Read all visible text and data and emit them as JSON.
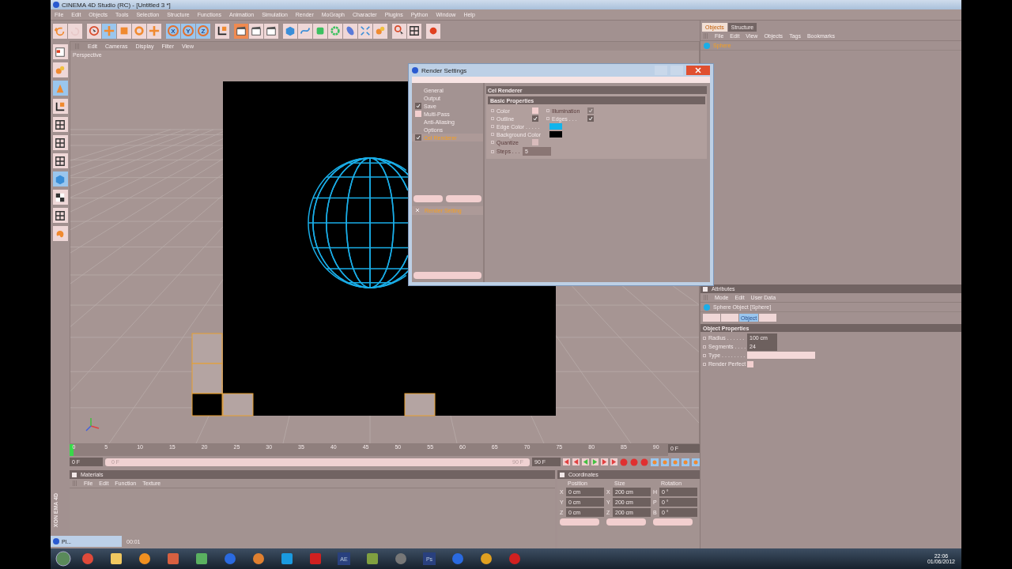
{
  "window": {
    "title": "CINEMA 4D Studio (RC) - [Untitled 3 *]"
  },
  "menu": [
    "File",
    "Edit",
    "Objects",
    "Tools",
    "Selection",
    "Structure",
    "Functions",
    "Animation",
    "Simulation",
    "Render",
    "MoGraph",
    "Character",
    "Plugins",
    "Python",
    "Window",
    "Help"
  ],
  "toolbar": [
    {
      "kind": "curved-arrow",
      "selected": false
    },
    {
      "kind": "faded-arrow",
      "selected": false
    },
    {
      "kind": "cursor",
      "selected": false
    },
    {
      "kind": "cross-arrows",
      "selected": true
    },
    {
      "kind": "square",
      "selected": false
    },
    {
      "kind": "ring",
      "selected": false
    },
    {
      "kind": "axis-arrows",
      "selected": false
    },
    {
      "kind": "axis",
      "label": "X",
      "selected": true
    },
    {
      "kind": "axis",
      "label": "Y",
      "selected": true
    },
    {
      "kind": "axis",
      "label": "Z",
      "selected": true
    },
    {
      "kind": "corner-axes",
      "selected": false
    },
    {
      "kind": "clapperboard",
      "selected": true
    },
    {
      "kind": "clapperboard",
      "selected": false
    },
    {
      "kind": "clapperboard",
      "selected": false
    },
    {
      "kind": "cube",
      "selected": false
    },
    {
      "kind": "curve",
      "selected": false
    },
    {
      "kind": "beveled-cube",
      "selected": false
    },
    {
      "kind": "gear",
      "selected": false
    },
    {
      "kind": "capsule",
      "selected": false
    },
    {
      "kind": "scatter-arrows",
      "selected": false
    },
    {
      "kind": "blobs",
      "selected": false
    },
    {
      "kind": "cursor-dot",
      "selected": false
    },
    {
      "kind": "grid",
      "selected": false
    },
    {
      "kind": "record",
      "selected": false
    }
  ],
  "left_tools": [
    {
      "kind": "window-layout",
      "selected": false
    },
    {
      "kind": "blobs",
      "selected": false
    },
    {
      "kind": "cone",
      "selected": true
    },
    {
      "kind": "corner-axes",
      "selected": false
    },
    {
      "kind": "grid",
      "selected": false
    },
    {
      "kind": "grid",
      "selected": false
    },
    {
      "kind": "grid",
      "selected": false
    },
    {
      "kind": "cube",
      "selected": true
    },
    {
      "kind": "checkerboard",
      "selected": false
    },
    {
      "kind": "grid",
      "selected": false
    },
    {
      "kind": "blob",
      "selected": false
    }
  ],
  "viewport": {
    "menu": [
      "Edit",
      "Cameras",
      "Display",
      "Filter",
      "View"
    ],
    "camera": "Perspective"
  },
  "render_settings": {
    "title": "Render Settings",
    "tree": [
      {
        "label": "General",
        "kind": "plain",
        "selected": false
      },
      {
        "label": "Output",
        "kind": "plain",
        "selected": false
      },
      {
        "label": "Save",
        "kind": "check",
        "checked": true,
        "selected": false
      },
      {
        "label": "Multi-Pass",
        "kind": "check",
        "checked": false,
        "selected": false
      },
      {
        "label": "Anti-Aliasing",
        "kind": "plain",
        "selected": false
      },
      {
        "label": "Options",
        "kind": "plain",
        "selected": false
      },
      {
        "label": "Cel Renderer",
        "kind": "check",
        "checked": true,
        "selected": true
      }
    ],
    "setting": "Render Setting",
    "panel_title": "Cel Renderer",
    "section": "Basic Properties",
    "params": [
      [
        {
          "label": "Color",
          "kind": "checkbox",
          "checked": false,
          "disabled": false
        },
        {
          "label": "Illumination",
          "kind": "checkbox",
          "checked": true,
          "disabled": true
        }
      ],
      [
        {
          "label": "Outline",
          "kind": "checkbox",
          "checked": true,
          "disabled": false
        },
        {
          "label": "Edges . . .",
          "kind": "checkbox",
          "checked": true,
          "disabled": false
        }
      ],
      [
        {
          "label": "Edge Color . . . . .",
          "kind": "color",
          "color": "#12b4ec",
          "disabled": false
        }
      ],
      [
        {
          "label": "Background Color",
          "kind": "color",
          "color": "#000000",
          "disabled": false
        }
      ],
      [
        {
          "label": "Quantize",
          "kind": "checkbox",
          "checked": false,
          "disabled": true
        }
      ],
      [
        {
          "label": "Steps . . .",
          "kind": "number",
          "value": "5",
          "disabled": true
        }
      ]
    ]
  },
  "objects_panel": {
    "tabs": [
      {
        "label": "Objects",
        "selected": true
      },
      {
        "label": "Structure",
        "selected": false
      }
    ],
    "menu": [
      "File",
      "Edit",
      "View",
      "Objects",
      "Tags",
      "Bookmarks"
    ],
    "objects": [
      {
        "name": "Sphere",
        "selected": true
      }
    ]
  },
  "attributes": {
    "title": "Attributes",
    "menu": [
      "Mode",
      "Edit",
      "User Data"
    ],
    "object": "Sphere Object [Sphere]",
    "tabs": [
      {
        "selected": false
      },
      {
        "selected": false
      },
      {
        "label": "Object",
        "selected": true
      },
      {
        "selected": false
      }
    ],
    "section": "Object Properties",
    "fields": [
      {
        "label": "Radius . . . . . .",
        "kind": "number",
        "value": "100 cm"
      },
      {
        "label": "Segments . . . .",
        "kind": "number",
        "value": "24"
      },
      {
        "label": "Type . . . . . . . .",
        "kind": "dropdown"
      },
      {
        "label": "Render Perfect",
        "kind": "checkbox",
        "checked": false
      }
    ]
  },
  "timeline": {
    "ticks": [
      "0",
      "5",
      "10",
      "15",
      "20",
      "25",
      "30",
      "35",
      "40",
      "45",
      "50",
      "55",
      "60",
      "65",
      "70",
      "75",
      "80",
      "85",
      "90"
    ],
    "level": 0,
    "current": "0 F",
    "start": "0 F",
    "range": {
      "level": 1,
      "start": "0 F",
      "end": "90 F"
    },
    "end": "90 F"
  },
  "materials": {
    "title": "Materials",
    "menu": [
      "File",
      "Edit",
      "Function",
      "Texture"
    ]
  },
  "coordinates": {
    "title": "Coordinates",
    "columns": [
      "Position",
      "Size",
      "Rotation"
    ],
    "rows": [
      [
        {
          "axis": "X",
          "value": "0 cm"
        },
        {
          "axis": "X",
          "value": "200 cm"
        },
        {
          "axis": "H",
          "value": "0 °"
        }
      ],
      [
        {
          "axis": "Y",
          "value": "0 cm"
        },
        {
          "axis": "Y",
          "value": "200 cm"
        },
        {
          "axis": "P",
          "value": "0 °"
        }
      ],
      [
        {
          "axis": "Z",
          "value": "0 cm"
        },
        {
          "axis": "Z",
          "value": "200 cm"
        },
        {
          "axis": "B",
          "value": "0 °"
        }
      ]
    ]
  },
  "logo": [
    "XON",
    "EMA 4D"
  ],
  "minimized": {
    "title": "Pl...",
    "time": "00:01"
  },
  "taskbar": {
    "apps": [
      {
        "kind": "ring"
      },
      {
        "kind": "folder"
      },
      {
        "kind": "play"
      },
      {
        "kind": "tray"
      },
      {
        "kind": "calendar"
      },
      {
        "kind": "globe"
      },
      {
        "kind": "brush"
      },
      {
        "kind": "speech"
      },
      {
        "kind": "box"
      },
      {
        "kind": "letters",
        "label": "AE"
      },
      {
        "kind": "flag"
      },
      {
        "kind": "steam"
      },
      {
        "kind": "letters",
        "label": "Ps"
      },
      {
        "kind": "globe"
      },
      {
        "kind": "fruit"
      },
      {
        "kind": "swoosh"
      }
    ],
    "time": "22:06",
    "date": "01/06/2012"
  }
}
